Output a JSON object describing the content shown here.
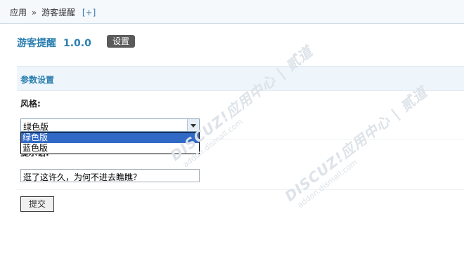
{
  "breadcrumb": {
    "root": "应用",
    "separator": "»",
    "current": "游客提醒",
    "add": "[+]"
  },
  "plugin": {
    "name": "游客提醒",
    "version": "1.0.0",
    "settings_button": "设置"
  },
  "section": {
    "title": "参数设置"
  },
  "form": {
    "style_label": "风格:",
    "style_select": {
      "value": "绿色版",
      "options": [
        "绿色版",
        "蓝色版"
      ],
      "highlighted": "绿色版"
    },
    "tip_label": "提示语:",
    "tip_input": {
      "value": "逛了这许久，为何不进去瞧瞧？"
    },
    "submit_label": "提交"
  },
  "watermark": {
    "brand": "DISCUZ!应用中心 | 贰道",
    "domain": "addon.dismall.com"
  },
  "colors": {
    "accent": "#2b7fb0",
    "topbar_bg": "#f5f9fc",
    "section_bg": "#eef5fb",
    "selection": "#3169c6"
  }
}
